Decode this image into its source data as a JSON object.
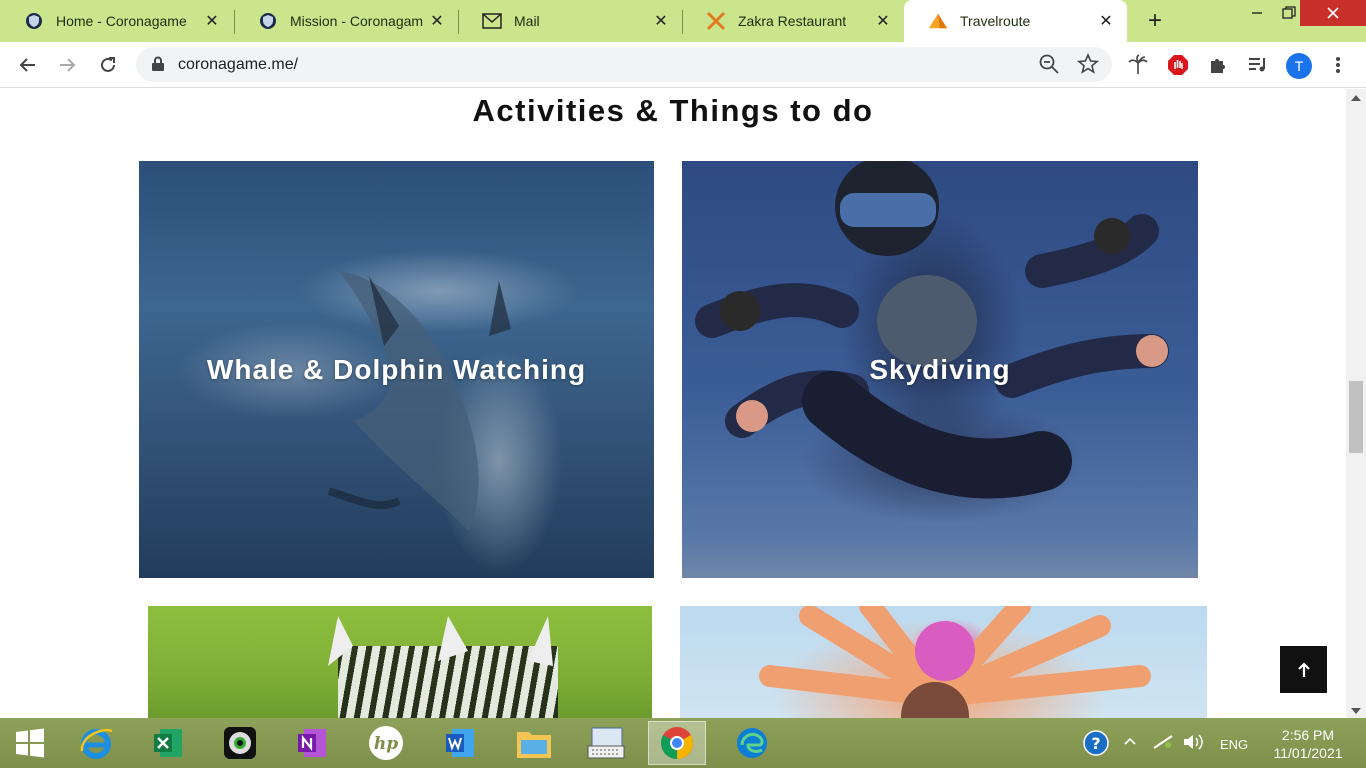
{
  "browser": {
    "tabs": [
      {
        "label": "Home - Coronagame",
        "icon": "shield-icon"
      },
      {
        "label": "Mission - Coronagam",
        "icon": "shield-icon"
      },
      {
        "label": "Mail",
        "icon": "mail-icon"
      },
      {
        "label": "Zakra Restaurant",
        "icon": "crossed-utensils-icon"
      },
      {
        "label": "Travelroute",
        "icon": "mountain-icon"
      }
    ],
    "url": "coronagame.me/",
    "profile_initial": "T"
  },
  "page": {
    "heading": "Activities & Things to do",
    "cards": [
      {
        "title": "Whale & Dolphin Watching"
      },
      {
        "title": "Skydiving"
      },
      {
        "title": ""
      },
      {
        "title": ""
      }
    ]
  },
  "taskbar": {
    "language": "ENG",
    "time": "2:56 PM",
    "date": "11/01/2021"
  },
  "colors": {
    "tab_strip": "#cbe58d",
    "close_button": "#c9302c",
    "profile": "#1a73e8"
  }
}
